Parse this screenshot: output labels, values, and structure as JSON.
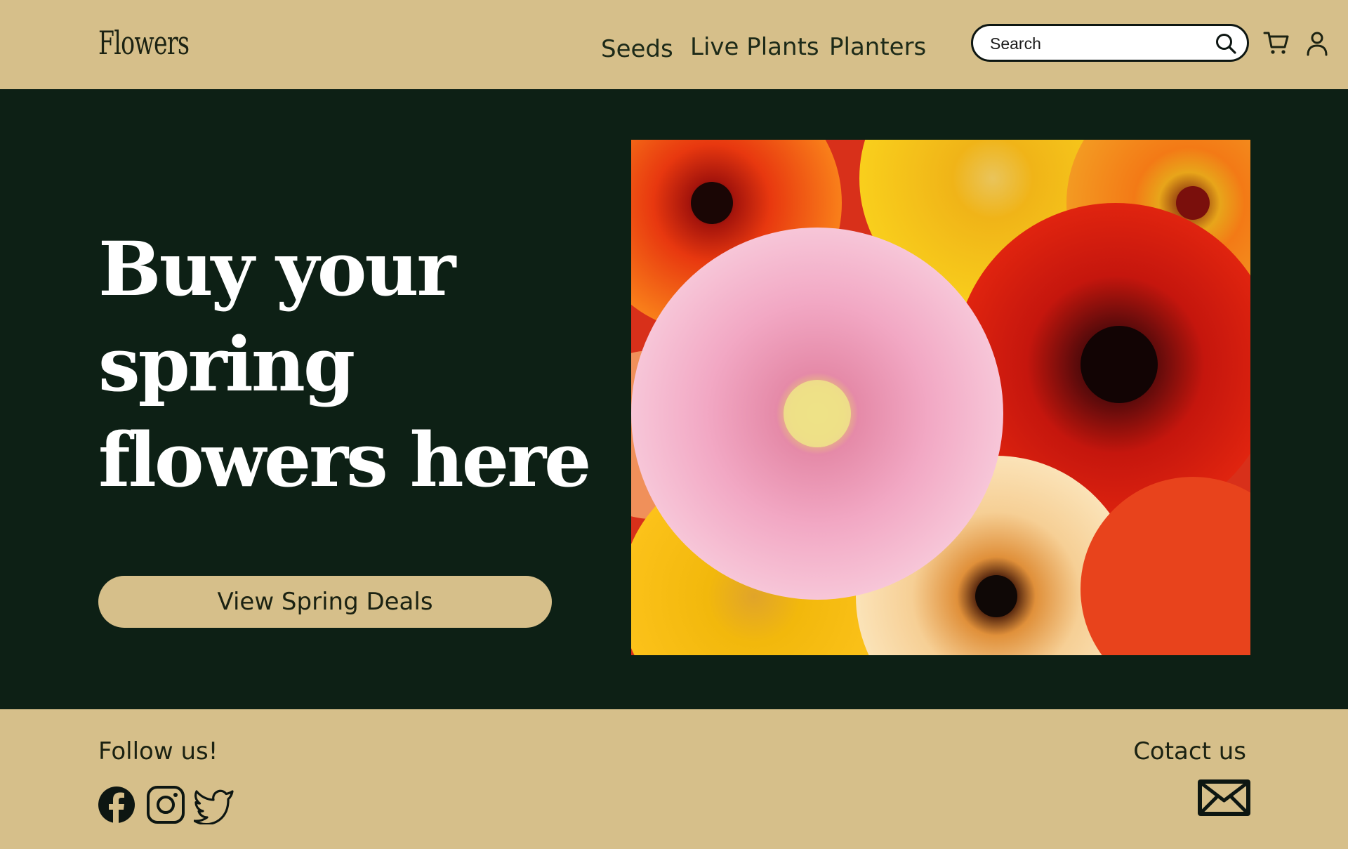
{
  "header": {
    "logo": "Flowers",
    "nav": [
      "Seeds",
      "Live Plants",
      "Planters"
    ],
    "search_placeholder": "Search",
    "icons": [
      "search-icon",
      "cart-icon",
      "user-icon"
    ]
  },
  "hero": {
    "title_lines": [
      "Buy your",
      "spring",
      "flowers here"
    ],
    "cta_label": "View Spring Deals",
    "image": "gerbera-daisies-photo"
  },
  "footer": {
    "follow_label": "Follow us!",
    "contact_label": "Cotact us",
    "social_icons": [
      "facebook-icon",
      "instagram-icon",
      "twitter-icon"
    ],
    "contact_icon": "mail-icon"
  },
  "colors": {
    "tan": "#d6bf8a",
    "dark_green": "#0d2015",
    "text_dark": "#1b2212",
    "white": "#ffffff"
  }
}
